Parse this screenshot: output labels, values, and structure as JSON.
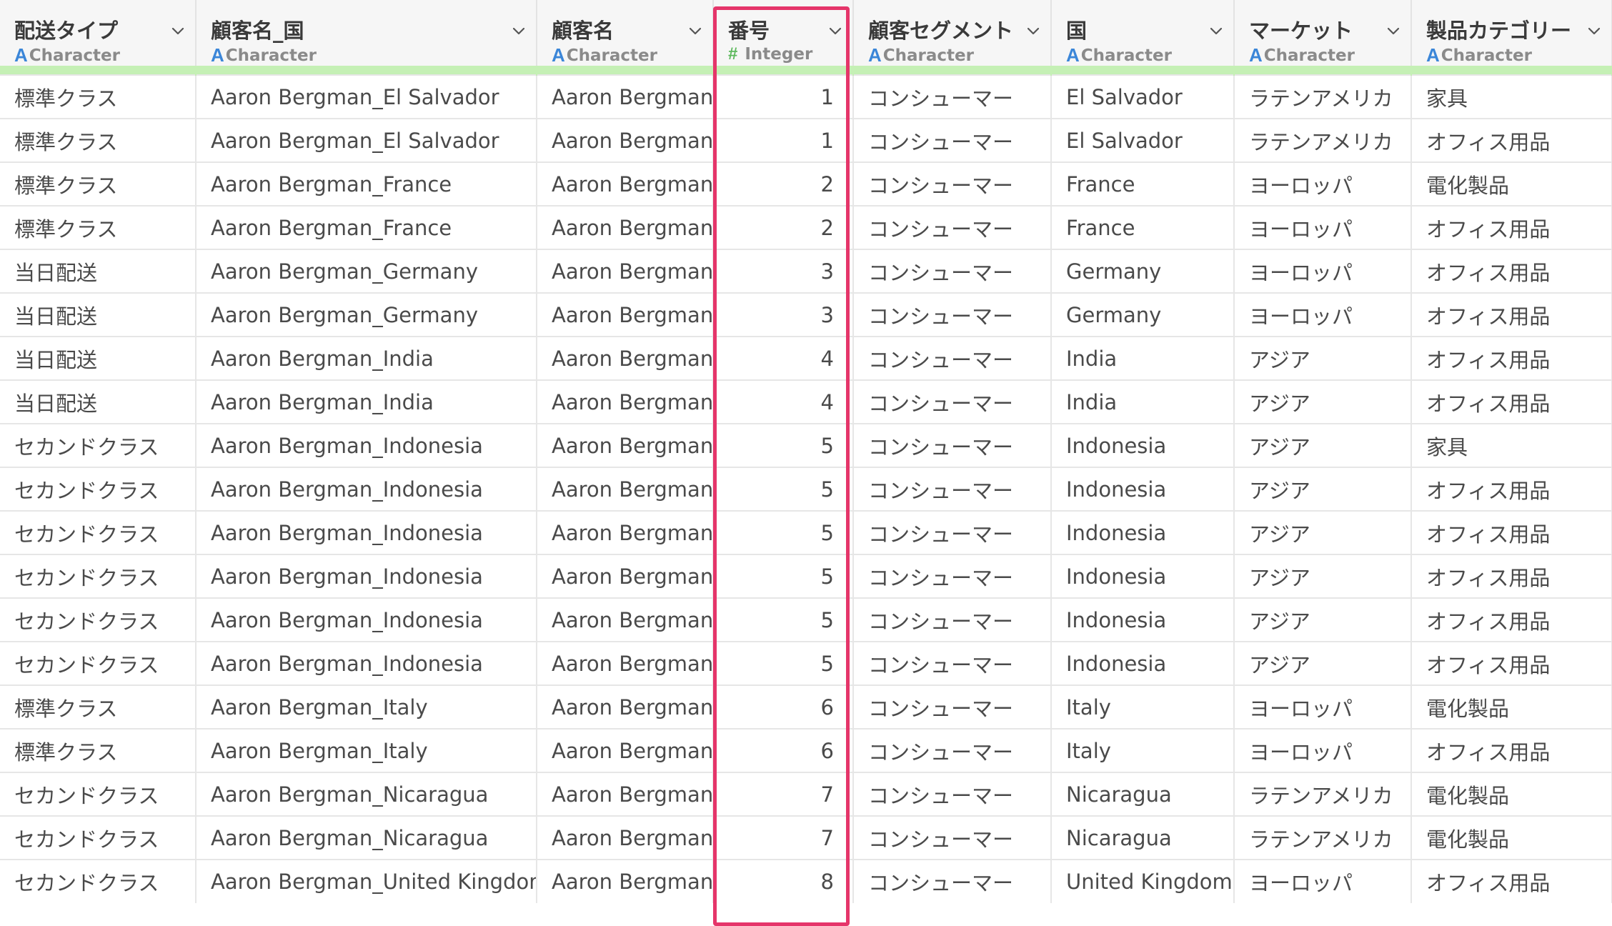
{
  "highlight_color": "#e5356a",
  "type_icons": {
    "character": "A",
    "integer": "#"
  },
  "columns": [
    {
      "name": "配送タイプ",
      "type": "Character"
    },
    {
      "name": "顧客名_国",
      "type": "Character"
    },
    {
      "name": "顧客名",
      "type": "Character"
    },
    {
      "name": "番号",
      "type": "Integer"
    },
    {
      "name": "顧客セグメント",
      "type": "Character"
    },
    {
      "name": "国",
      "type": "Character"
    },
    {
      "name": "マーケット",
      "type": "Character"
    },
    {
      "name": "製品カテゴリー",
      "type": "Character"
    }
  ],
  "rows": [
    [
      "標準クラス",
      "Aaron Bergman_El Salvador",
      "Aaron Bergman",
      "1",
      "コンシューマー",
      "El Salvador",
      "ラテンアメリカ",
      "家具"
    ],
    [
      "標準クラス",
      "Aaron Bergman_El Salvador",
      "Aaron Bergman",
      "1",
      "コンシューマー",
      "El Salvador",
      "ラテンアメリカ",
      "オフィス用品"
    ],
    [
      "標準クラス",
      "Aaron Bergman_France",
      "Aaron Bergman",
      "2",
      "コンシューマー",
      "France",
      "ヨーロッパ",
      "電化製品"
    ],
    [
      "標準クラス",
      "Aaron Bergman_France",
      "Aaron Bergman",
      "2",
      "コンシューマー",
      "France",
      "ヨーロッパ",
      "オフィス用品"
    ],
    [
      "当日配送",
      "Aaron Bergman_Germany",
      "Aaron Bergman",
      "3",
      "コンシューマー",
      "Germany",
      "ヨーロッパ",
      "オフィス用品"
    ],
    [
      "当日配送",
      "Aaron Bergman_Germany",
      "Aaron Bergman",
      "3",
      "コンシューマー",
      "Germany",
      "ヨーロッパ",
      "オフィス用品"
    ],
    [
      "当日配送",
      "Aaron Bergman_India",
      "Aaron Bergman",
      "4",
      "コンシューマー",
      "India",
      "アジア",
      "オフィス用品"
    ],
    [
      "当日配送",
      "Aaron Bergman_India",
      "Aaron Bergman",
      "4",
      "コンシューマー",
      "India",
      "アジア",
      "オフィス用品"
    ],
    [
      "セカンドクラス",
      "Aaron Bergman_Indonesia",
      "Aaron Bergman",
      "5",
      "コンシューマー",
      "Indonesia",
      "アジア",
      "家具"
    ],
    [
      "セカンドクラス",
      "Aaron Bergman_Indonesia",
      "Aaron Bergman",
      "5",
      "コンシューマー",
      "Indonesia",
      "アジア",
      "オフィス用品"
    ],
    [
      "セカンドクラス",
      "Aaron Bergman_Indonesia",
      "Aaron Bergman",
      "5",
      "コンシューマー",
      "Indonesia",
      "アジア",
      "オフィス用品"
    ],
    [
      "セカンドクラス",
      "Aaron Bergman_Indonesia",
      "Aaron Bergman",
      "5",
      "コンシューマー",
      "Indonesia",
      "アジア",
      "オフィス用品"
    ],
    [
      "セカンドクラス",
      "Aaron Bergman_Indonesia",
      "Aaron Bergman",
      "5",
      "コンシューマー",
      "Indonesia",
      "アジア",
      "オフィス用品"
    ],
    [
      "セカンドクラス",
      "Aaron Bergman_Indonesia",
      "Aaron Bergman",
      "5",
      "コンシューマー",
      "Indonesia",
      "アジア",
      "オフィス用品"
    ],
    [
      "標準クラス",
      "Aaron Bergman_Italy",
      "Aaron Bergman",
      "6",
      "コンシューマー",
      "Italy",
      "ヨーロッパ",
      "電化製品"
    ],
    [
      "標準クラス",
      "Aaron Bergman_Italy",
      "Aaron Bergman",
      "6",
      "コンシューマー",
      "Italy",
      "ヨーロッパ",
      "オフィス用品"
    ],
    [
      "セカンドクラス",
      "Aaron Bergman_Nicaragua",
      "Aaron Bergman",
      "7",
      "コンシューマー",
      "Nicaragua",
      "ラテンアメリカ",
      "電化製品"
    ],
    [
      "セカンドクラス",
      "Aaron Bergman_Nicaragua",
      "Aaron Bergman",
      "7",
      "コンシューマー",
      "Nicaragua",
      "ラテンアメリカ",
      "電化製品"
    ],
    [
      "セカンドクラス",
      "Aaron Bergman_United Kingdom",
      "Aaron Bergman",
      "8",
      "コンシューマー",
      "United Kingdom",
      "ヨーロッパ",
      "オフィス用品"
    ]
  ]
}
